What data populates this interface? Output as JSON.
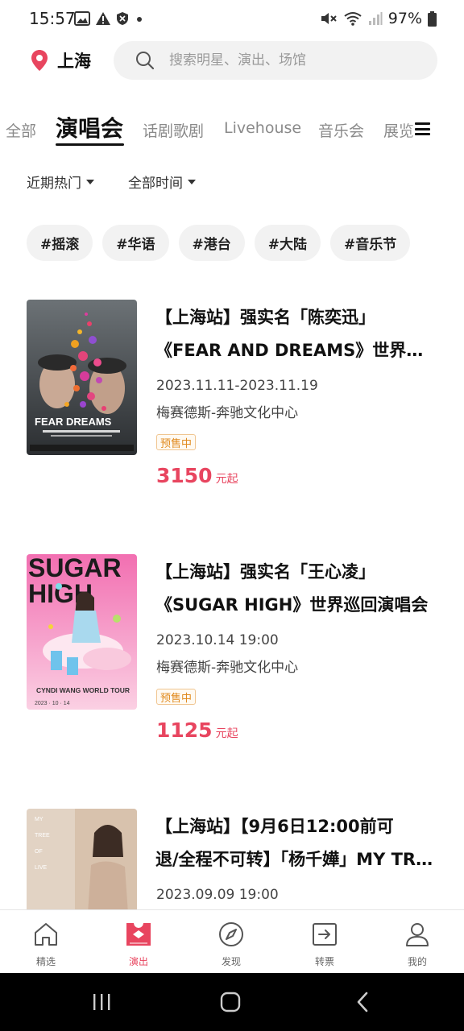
{
  "status_bar": {
    "time": "15:57",
    "battery": "97%"
  },
  "header": {
    "city": "上海",
    "search_placeholder": "搜索明星、演出、场馆"
  },
  "tabs": [
    {
      "label": "全部"
    },
    {
      "label": "演唱会"
    },
    {
      "label": "话剧歌剧"
    },
    {
      "label": "Livehouse"
    },
    {
      "label": "音乐会"
    },
    {
      "label": "展览"
    }
  ],
  "filters": {
    "sort": "近期热门",
    "time": "全部时间"
  },
  "tags": [
    "#摇滚",
    "#华语",
    "#港台",
    "#大陆",
    "#音乐节"
  ],
  "events": [
    {
      "title_line1": "【上海站】强实名「陈奕迅」",
      "title_line2": "《FEAR AND DREAMS》世界巡回演唱会",
      "date": "2023.11.11-2023.11.19",
      "venue": "梅赛德斯-奔驰文化中心",
      "badge": "预售中",
      "price": "3150",
      "price_unit": "元起",
      "poster_text": "FEAR DREAMS"
    },
    {
      "title_line1": "【上海站】强实名「王心凌」",
      "title_line2": "《SUGAR HIGH》世界巡回演唱会",
      "date": "2023.10.14 19:00",
      "venue": "梅赛德斯-奔驰文化中心",
      "badge": "预售中",
      "price": "1125",
      "price_unit": "元起",
      "poster_text": "SUGAR HIGH",
      "poster_subtext": "CYNDI WANG WORLD TOUR",
      "poster_date": "2023 · 10 · 14"
    },
    {
      "title_line1": "【上海站】【9月6日12:00前可",
      "title_line2": "退/全程不可转】「杨千嬅」MY TREE OF LIVE",
      "date": "2023.09.09 19:00",
      "poster_text": "MY TREE OF LIVE"
    }
  ],
  "bottom_nav": [
    {
      "label": "精选",
      "icon": "home-icon"
    },
    {
      "label": "演出",
      "icon": "ticket-icon"
    },
    {
      "label": "发现",
      "icon": "compass-icon"
    },
    {
      "label": "转票",
      "icon": "transfer-icon"
    },
    {
      "label": "我的",
      "icon": "profile-icon"
    }
  ],
  "colors": {
    "accent": "#e8455f",
    "presale": "#e08a1e"
  }
}
